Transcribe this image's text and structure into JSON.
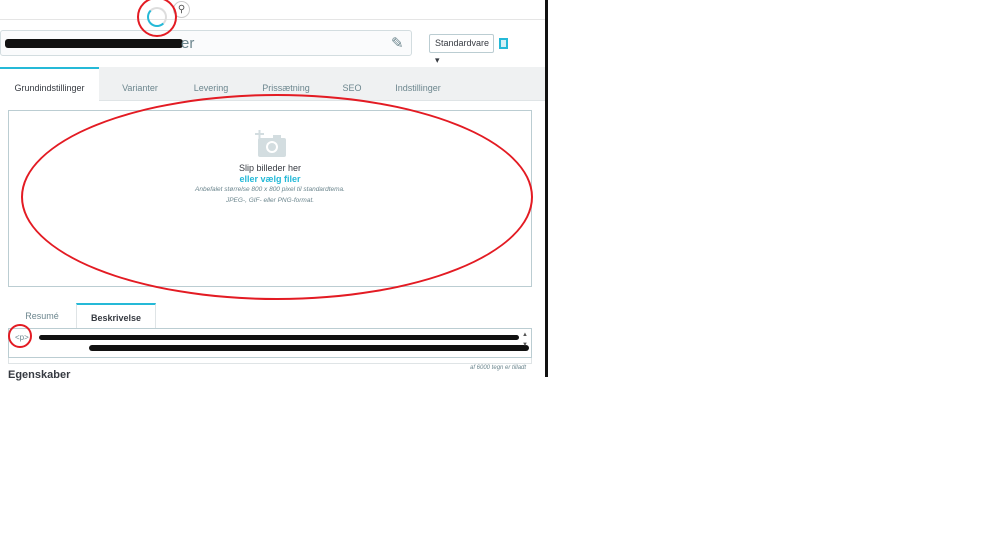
{
  "header": {
    "search_icon": "search-icon",
    "loading": "spinner"
  },
  "product": {
    "name_visible": "er",
    "type_select": "Standardvare"
  },
  "tabs": [
    {
      "label": "Grundindstillinger",
      "active": true
    },
    {
      "label": "Varianter"
    },
    {
      "label": "Levering"
    },
    {
      "label": "Prissætning"
    },
    {
      "label": "SEO"
    },
    {
      "label": "Indstillinger"
    }
  ],
  "dropzone": {
    "title": "Slip billeder her",
    "link": "eller vælg filer",
    "hint1": "Anbefalet størrelse 800 x 800 pixel til standardtema.",
    "hint2": "JPEG-, GIF- eller PNG-format."
  },
  "desc_tabs": [
    {
      "label": "Resumé"
    },
    {
      "label": "Beskrivelse",
      "active": true
    }
  ],
  "description": {
    "text_start": "<p>",
    "counter": "af 6000 tegn er tilladt"
  },
  "section": {
    "title": "Egenskaber"
  },
  "colors": {
    "accent": "#25b9d7",
    "annotation": "#e31b23"
  }
}
